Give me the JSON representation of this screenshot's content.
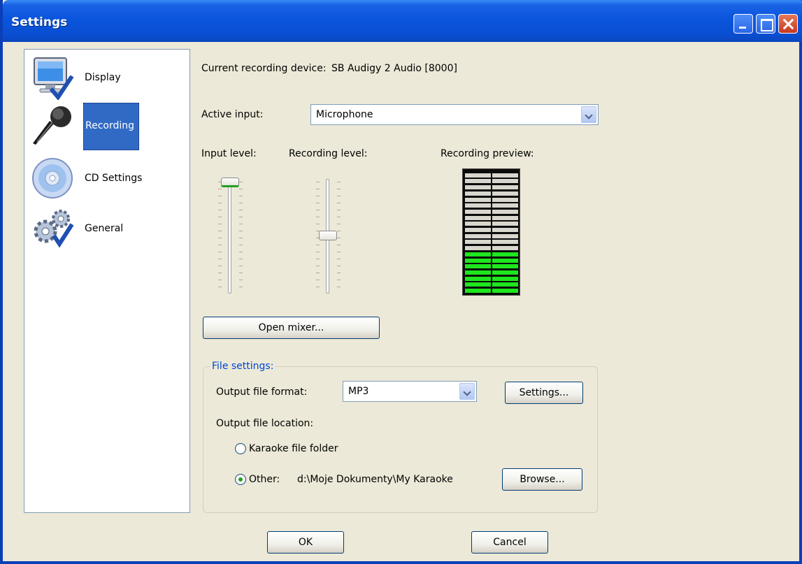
{
  "window": {
    "title": "Settings"
  },
  "sidebar": {
    "items": [
      {
        "label": "Display",
        "icon": "monitor-check-icon"
      },
      {
        "label": "Recording",
        "icon": "microphone-icon",
        "selected": true
      },
      {
        "label": "CD Settings",
        "icon": "cd-icon"
      },
      {
        "label": "General",
        "icon": "gears-check-icon"
      }
    ]
  },
  "recording": {
    "device_label": "Current recording device:",
    "device_value": "SB Audigy 2 Audio [8000]",
    "active_input_label": "Active input:",
    "active_input_value": "Microphone",
    "input_level_label": "Input level:",
    "recording_level_label": "Recording level:",
    "recording_preview_label": "Recording preview:",
    "input_level": 1.0,
    "recording_level": 0.5,
    "preview_level": 0.35,
    "open_mixer_label": "Open mixer..."
  },
  "file_settings": {
    "title": "File settings:",
    "format_label": "Output file format:",
    "format_value": "MP3",
    "settings_button": "Settings...",
    "location_label": "Output file location:",
    "option_karaoke": "Karaoke file folder",
    "option_other": "Other:",
    "other_path": "d:\\Moje Dokumenty\\My Karaoke",
    "browse_button": "Browse...",
    "selected_option": "other"
  },
  "footer": {
    "ok_label": "OK",
    "cancel_label": "Cancel"
  },
  "colors": {
    "titlebar": "#0a55dc",
    "selection": "#316ac5",
    "meter_on": "#1ee61e",
    "meter_off": "#d9d6cd",
    "group_title": "#0046d5"
  }
}
